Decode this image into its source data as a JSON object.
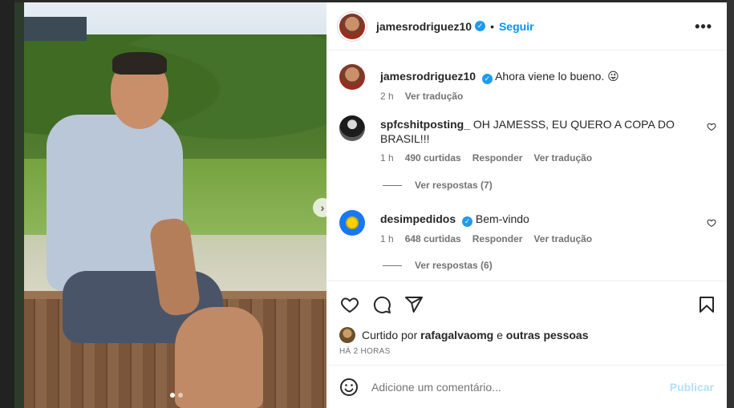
{
  "post": {
    "author": "jamesrodriguez10",
    "follow_label": "Seguir",
    "separator": "•",
    "more_label": "•••",
    "caption": {
      "username": "jamesrodriguez10",
      "text": "Ahora viene lo bueno. 😜",
      "time": "2 h",
      "translate": "Ver tradução"
    },
    "photo": {
      "next_icon": "chevron-right-icon",
      "slide_count": 2,
      "active_slide": 1
    }
  },
  "comments": [
    {
      "username": "spfcshitposting_",
      "text": "OH JAMESSS, EU QUERO A COPA DO BRASIL!!!",
      "time": "1 h",
      "likes": "490 curtidas",
      "reply": "Responder",
      "translate": "Ver tradução",
      "view_replies": "Ver respostas (7)"
    },
    {
      "username": "desimpedidos",
      "text": "Bem-vindo",
      "time": "1 h",
      "likes": "648 curtidas",
      "reply": "Responder",
      "translate": "Ver tradução",
      "view_replies": "Ver respostas (6)"
    }
  ],
  "actions": {
    "like_icon": "heart-icon",
    "comment_icon": "comment-icon",
    "share_icon": "share-icon",
    "save_icon": "bookmark-icon"
  },
  "likes": {
    "prefix": "Curtido por",
    "user": "rafagalvaomg",
    "joiner": "e",
    "others": "outras pessoas"
  },
  "timestamp": "HÁ 2 HORAS",
  "add_comment": {
    "placeholder": "Adicione um comentário...",
    "publish": "Publicar",
    "emoji_icon": "emoji-icon"
  },
  "colors": {
    "accent": "#0095f6",
    "verified": "#1d9bf0",
    "publish_disabled": "#b2dffc"
  }
}
